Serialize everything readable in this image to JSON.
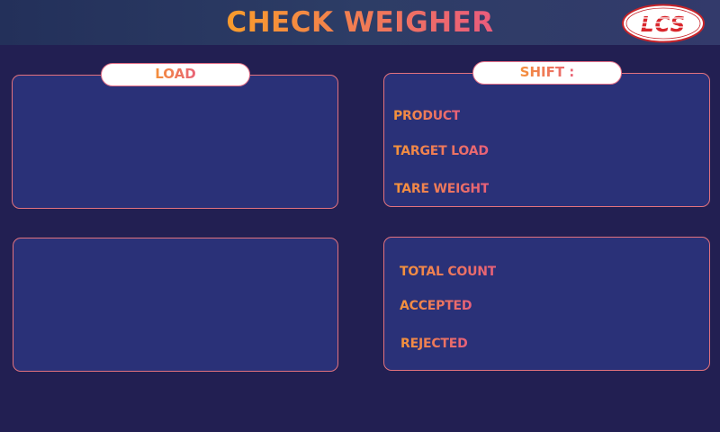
{
  "header": {
    "title": "CHECK WEIGHER",
    "logo_text": "LCS"
  },
  "load_panel": {
    "label": "LOAD"
  },
  "shift_panel": {
    "label": "SHIFT :",
    "fields": {
      "product": "PRODUCT",
      "target_load": "TARGET LOAD",
      "tare_weight": "TARE WEIGHT"
    }
  },
  "count_panel": {
    "fields": {
      "total_count": "TOTAL COUNT",
      "accepted": "ACCEPTED",
      "rejected": "REJECTED"
    }
  },
  "colors": {
    "background": "#221f52",
    "header": "#2d3d66",
    "panel_fill": "#2a3178",
    "panel_border": "#e2727e",
    "accent_orange": "#f4933a",
    "accent_pink": "#e8607a",
    "logo_red": "#d9262c"
  }
}
